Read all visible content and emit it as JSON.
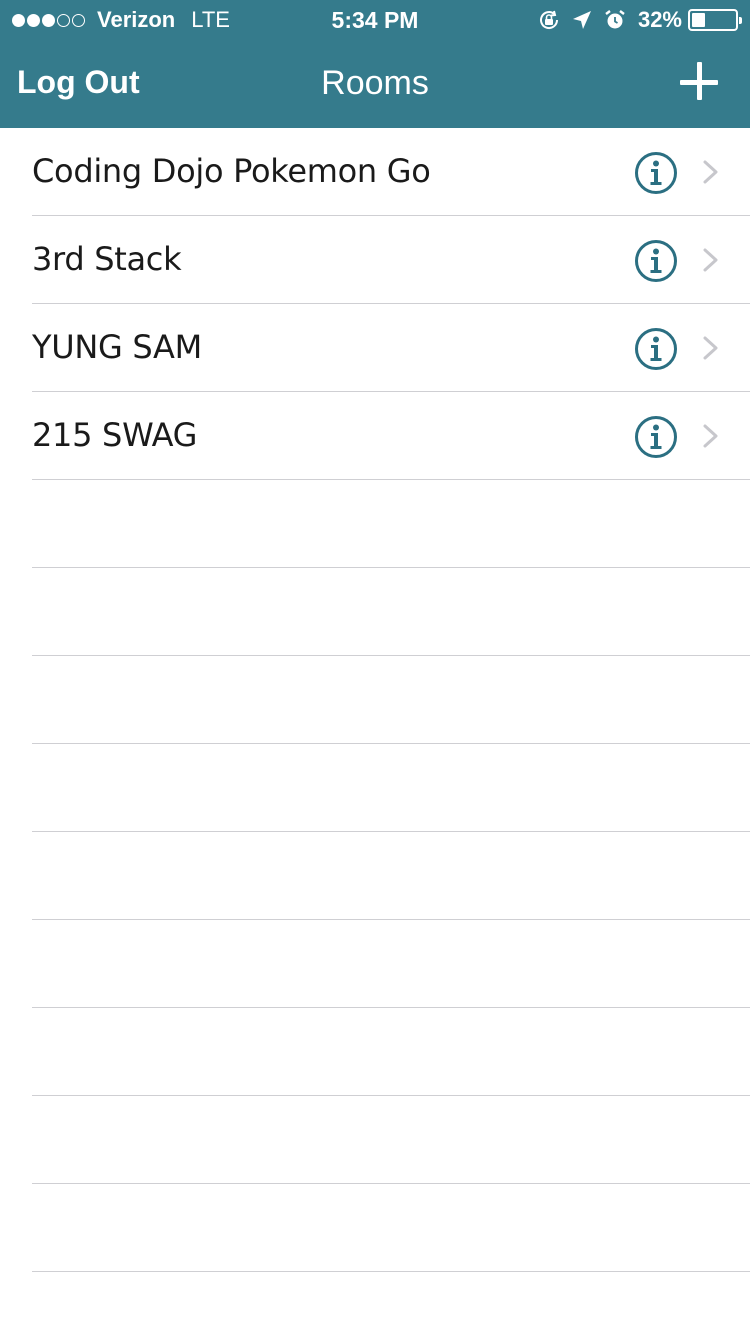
{
  "status_bar": {
    "signal_filled": 3,
    "signal_total": 5,
    "carrier": "Verizon",
    "network": "LTE",
    "time": "5:34 PM",
    "icons": [
      "orientation-lock-icon",
      "location-arrow-icon",
      "alarm-icon"
    ],
    "battery_percent": "32%",
    "battery_level": 0.32
  },
  "nav": {
    "left_label": "Log Out",
    "title": "Rooms",
    "right_icon": "plus-icon"
  },
  "colors": {
    "header_bg": "#357b8c",
    "accent": "#2b6f82",
    "chevron": "#c7c7cc",
    "separator": "#cfcfd3"
  },
  "rooms": [
    {
      "name": "Coding Dojo Pokemon Go"
    },
    {
      "name": "3rd Stack"
    },
    {
      "name": "YUNG SAM"
    },
    {
      "name": "215 SWAG"
    }
  ],
  "empty_rows": 10
}
